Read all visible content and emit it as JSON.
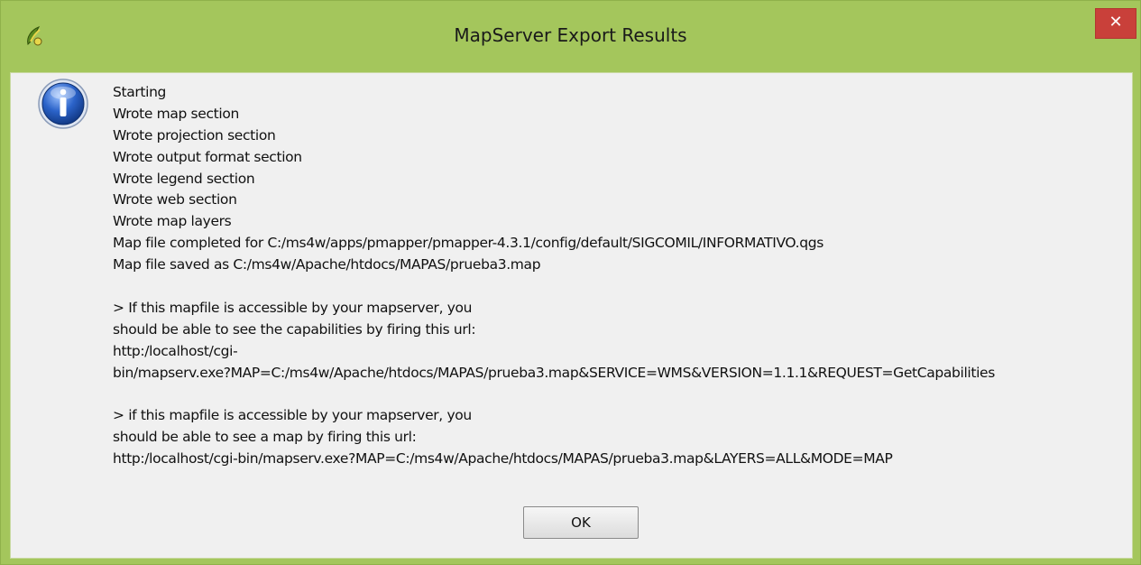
{
  "window": {
    "title": "MapServer Export Results",
    "close_label": "✕",
    "app_icon": "qgis-icon",
    "colors": {
      "titlebar": "#a4c65c",
      "close": "#c9403a",
      "client": "#f0f0f0"
    }
  },
  "dialog": {
    "icon": "info-icon",
    "lines": [
      "Starting",
      "Wrote map section",
      "Wrote projection section",
      "Wrote output format section",
      "Wrote legend section",
      "Wrote web section",
      "Wrote map layers",
      "Map file completed for C:/ms4w/apps/pmapper/pmapper-4.3.1/config/default/SIGCOMIL/INFORMATIVO.qgs",
      "Map file saved as C:/ms4w/Apache/htdocs/MAPAS/prueba3.map",
      "",
      "> If this mapfile is accessible by your mapserver, you",
      "should be able to see the capabilities by firing this url:",
      "http:/localhost/cgi-",
      "bin/mapserv.exe?MAP=C:/ms4w/Apache/htdocs/MAPAS/prueba3.map&SERVICE=WMS&VERSION=1.1.1&REQUEST=GetCapabilities",
      "",
      "> if this mapfile is accessible by your mapserver, you",
      "should be able to see a map by firing this url:",
      "http:/localhost/cgi-bin/mapserv.exe?MAP=C:/ms4w/Apache/htdocs/MAPAS/prueba3.map&LAYERS=ALL&MODE=MAP"
    ],
    "ok_label": "OK"
  }
}
